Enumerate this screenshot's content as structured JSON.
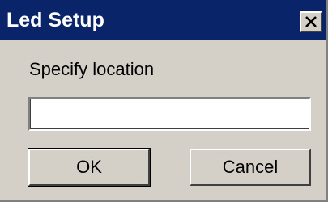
{
  "dialog": {
    "title": "Led Setup",
    "close_icon": "close-icon",
    "prompt": "Specify location",
    "location_value": "",
    "ok_label": "OK",
    "cancel_label": "Cancel"
  },
  "colors": {
    "titlebar": "#0a246a",
    "face": "#d4d0c8",
    "title_text": "#ffffff"
  }
}
